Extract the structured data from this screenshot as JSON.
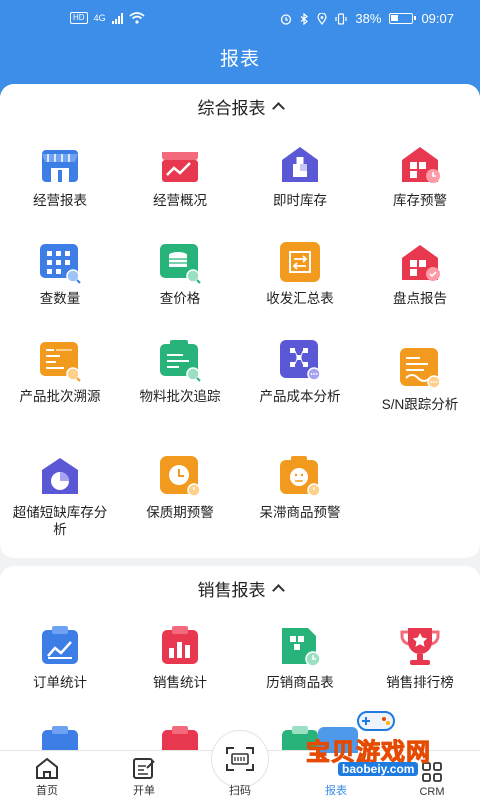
{
  "status_bar": {
    "network": "HD",
    "network_type": "4G",
    "battery_pct": "38%",
    "time": "09:07"
  },
  "app": {
    "title": "报表"
  },
  "sections": [
    {
      "title": "综合报表",
      "items": [
        {
          "label": "经营报表",
          "icon": "storefront-icon",
          "color": "#3d7de6"
        },
        {
          "label": "经营概况",
          "icon": "shop-trend-icon",
          "color": "#e8384f"
        },
        {
          "label": "即时库存",
          "icon": "warehouse-boxes-icon",
          "color": "#5b58d6"
        },
        {
          "label": "库存预警",
          "icon": "warehouse-alert-icon",
          "color": "#e8384f"
        },
        {
          "label": "查数量",
          "icon": "grid-search-icon",
          "color": "#3d7de6"
        },
        {
          "label": "查价格",
          "icon": "coins-search-icon",
          "color": "#28b37a"
        },
        {
          "label": "收发汇总表",
          "icon": "transfer-summary-icon",
          "color": "#f29a1e"
        },
        {
          "label": "盘点报告",
          "icon": "inventory-check-icon",
          "color": "#e8384f"
        },
        {
          "label": "产品批次溯源",
          "icon": "batch-trace-icon",
          "color": "#f29a1e"
        },
        {
          "label": "物料批次追踪",
          "icon": "material-track-icon",
          "color": "#28b37a"
        },
        {
          "label": "产品成本分析",
          "icon": "cost-analysis-icon",
          "color": "#5b58d6"
        },
        {
          "label": "S/N跟踪分析",
          "icon": "serial-track-icon",
          "color": "#f29a1e"
        },
        {
          "label": "超储短缺库存分析",
          "icon": "stock-pie-icon",
          "color": "#5b58d6"
        },
        {
          "label": "保质期预警",
          "icon": "shelf-life-clock-icon",
          "color": "#f29a1e"
        },
        {
          "label": "呆滞商品预警",
          "icon": "stagnant-goods-icon",
          "color": "#f29a1e"
        }
      ]
    },
    {
      "title": "销售报表",
      "items": [
        {
          "label": "订单统计",
          "icon": "order-stats-icon",
          "color": "#3d7de6"
        },
        {
          "label": "销售统计",
          "icon": "sales-stats-icon",
          "color": "#e8384f"
        },
        {
          "label": "历销商品表",
          "icon": "sales-history-icon",
          "color": "#28b37a"
        },
        {
          "label": "销售排行榜",
          "icon": "trophy-icon",
          "color": "#e8384f"
        }
      ]
    }
  ],
  "bottom_nav": [
    {
      "label": "首页",
      "icon": "home-icon"
    },
    {
      "label": "开单",
      "icon": "order-edit-icon"
    },
    {
      "label": "扫码",
      "icon": "scan-icon"
    },
    {
      "label": "报表",
      "icon": "report-icon",
      "active": true
    },
    {
      "label": "CRM",
      "icon": "crm-grid-icon"
    }
  ],
  "watermark": {
    "text": "宝贝游戏网",
    "url": "baobeiy.com"
  }
}
